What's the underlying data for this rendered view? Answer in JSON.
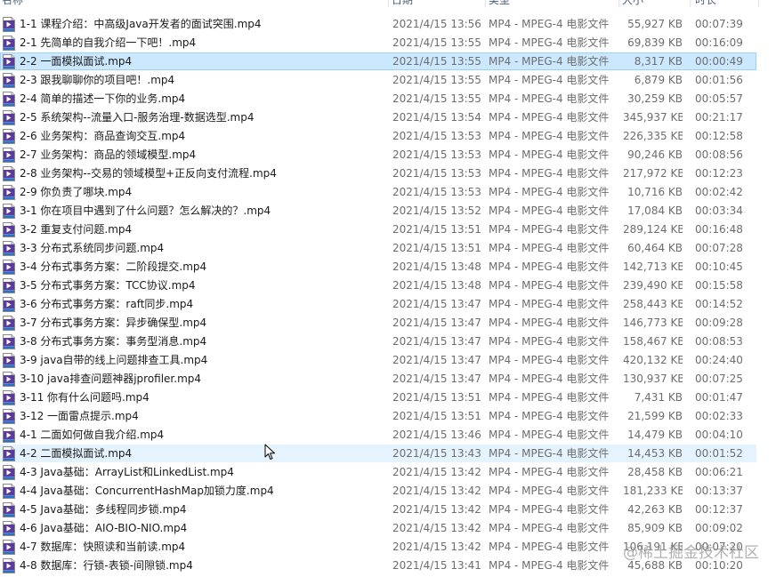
{
  "header": {
    "name": "名称",
    "date": "日期",
    "type": "类型",
    "size": "大小",
    "duration": "时长"
  },
  "icon": "mp4-video-file-icon",
  "rows": [
    {
      "name": "1-1 课程介绍：中高级Java开发者的面试突围.mp4",
      "date": "2021/4/15 13:56",
      "type": "MP4 - MPEG-4 电影文件",
      "size": "55,927 KB",
      "duration": "00:07:39"
    },
    {
      "name": "2-1 先简单的自我介绍一下吧！.mp4",
      "date": "2021/4/15 13:55",
      "type": "MP4 - MPEG-4 电影文件",
      "size": "69,839 KB",
      "duration": "00:16:09"
    },
    {
      "name": "2-2 一面模拟面试.mp4",
      "date": "2021/4/15 13:55",
      "type": "MP4 - MPEG-4 电影文件",
      "size": "8,317 KB",
      "duration": "00:00:49"
    },
    {
      "name": "2-3 跟我聊聊你的项目吧！.mp4",
      "date": "2021/4/15 13:55",
      "type": "MP4 - MPEG-4 电影文件",
      "size": "6,879 KB",
      "duration": "00:01:56"
    },
    {
      "name": "2-4 简单的描述一下你的业务.mp4",
      "date": "2021/4/15 13:55",
      "type": "MP4 - MPEG-4 电影文件",
      "size": "30,259 KB",
      "duration": "00:05:57"
    },
    {
      "name": "2-5 系统架构--流量入口-服务治理-数据选型.mp4",
      "date": "2021/4/15 13:54",
      "type": "MP4 - MPEG-4 电影文件",
      "size": "345,937 KB",
      "duration": "00:21:17"
    },
    {
      "name": "2-6 业务架构：商品查询交互.mp4",
      "date": "2021/4/15 13:53",
      "type": "MP4 - MPEG-4 电影文件",
      "size": "226,335 KB",
      "duration": "00:12:58"
    },
    {
      "name": "2-7 业务架构：商品的领域模型.mp4",
      "date": "2021/4/15 13:53",
      "type": "MP4 - MPEG-4 电影文件",
      "size": "90,246 KB",
      "duration": "00:08:56"
    },
    {
      "name": "2-8 业务架构--交易的领域模型+正反向支付流程.mp4",
      "date": "2021/4/15 13:53",
      "type": "MP4 - MPEG-4 电影文件",
      "size": "217,972 KB",
      "duration": "00:12:23"
    },
    {
      "name": "2-9 你负责了哪块.mp4",
      "date": "2021/4/15 13:53",
      "type": "MP4 - MPEG-4 电影文件",
      "size": "10,716 KB",
      "duration": "00:02:42"
    },
    {
      "name": "3-1 你在项目中遇到了什么问题？怎么解决的？.mp4",
      "date": "2021/4/15 13:52",
      "type": "MP4 - MPEG-4 电影文件",
      "size": "17,084 KB",
      "duration": "00:03:34"
    },
    {
      "name": "3-2 重复支付问题.mp4",
      "date": "2021/4/15 13:51",
      "type": "MP4 - MPEG-4 电影文件",
      "size": "289,124 KB",
      "duration": "00:16:48"
    },
    {
      "name": "3-3 分布式系统同步问题.mp4",
      "date": "2021/4/15 13:51",
      "type": "MP4 - MPEG-4 电影文件",
      "size": "60,464 KB",
      "duration": "00:07:28"
    },
    {
      "name": "3-4 分布式事务方案：二阶段提交.mp4",
      "date": "2021/4/15 13:48",
      "type": "MP4 - MPEG-4 电影文件",
      "size": "142,713 KB",
      "duration": "00:10:45"
    },
    {
      "name": "3-5 分布式事务方案：TCC协议.mp4",
      "date": "2021/4/15 13:48",
      "type": "MP4 - MPEG-4 电影文件",
      "size": "239,490 KB",
      "duration": "00:15:58"
    },
    {
      "name": "3-6 分布式事务方案：raft同步.mp4",
      "date": "2021/4/15 13:47",
      "type": "MP4 - MPEG-4 电影文件",
      "size": "258,443 KB",
      "duration": "00:14:52"
    },
    {
      "name": "3-7 分布式事务方案：异步确保型.mp4",
      "date": "2021/4/15 13:47",
      "type": "MP4 - MPEG-4 电影文件",
      "size": "146,773 KB",
      "duration": "00:09:28"
    },
    {
      "name": "3-8 分布式事务方案：事务型消息.mp4",
      "date": "2021/4/15 13:47",
      "type": "MP4 - MPEG-4 电影文件",
      "size": "158,467 KB",
      "duration": "00:08:53"
    },
    {
      "name": "3-9 java自带的线上问题排查工具.mp4",
      "date": "2021/4/15 13:47",
      "type": "MP4 - MPEG-4 电影文件",
      "size": "420,132 KB",
      "duration": "00:24:40"
    },
    {
      "name": "3-10 java排查问题神器jprofiler.mp4",
      "date": "2021/4/15 13:47",
      "type": "MP4 - MPEG-4 电影文件",
      "size": "130,937 KB",
      "duration": "00:07:25"
    },
    {
      "name": "3-11 你有什么问题吗.mp4",
      "date": "2021/4/15 13:51",
      "type": "MP4 - MPEG-4 电影文件",
      "size": "7,431 KB",
      "duration": "00:01:47"
    },
    {
      "name": "3-12 一面雷点提示.mp4",
      "date": "2021/4/15 13:51",
      "type": "MP4 - MPEG-4 电影文件",
      "size": "21,599 KB",
      "duration": "00:02:33"
    },
    {
      "name": "4-1 二面如何做自我介绍.mp4",
      "date": "2021/4/15 13:46",
      "type": "MP4 - MPEG-4 电影文件",
      "size": "14,479 KB",
      "duration": "00:04:10"
    },
    {
      "name": "4-2 二面模拟面试.mp4",
      "date": "2021/4/15 13:43",
      "type": "MP4 - MPEG-4 电影文件",
      "size": "14,453 KB",
      "duration": "00:01:52"
    },
    {
      "name": "4-3 Java基础：ArrayList和LinkedList.mp4",
      "date": "2021/4/15 13:42",
      "type": "MP4 - MPEG-4 电影文件",
      "size": "28,458 KB",
      "duration": "00:06:21"
    },
    {
      "name": "4-4 Java基础：ConcurrentHashMap加锁力度.mp4",
      "date": "2021/4/15 13:42",
      "type": "MP4 - MPEG-4 电影文件",
      "size": "181,233 KB",
      "duration": "00:13:37"
    },
    {
      "name": "4-5 Java基础：多线程同步锁.mp4",
      "date": "2021/4/15 13:42",
      "type": "MP4 - MPEG-4 电影文件",
      "size": "42,263 KB",
      "duration": "00:12:37"
    },
    {
      "name": "4-6 Java基础：AIO-BIO-NIO.mp4",
      "date": "2021/4/15 13:42",
      "type": "MP4 - MPEG-4 电影文件",
      "size": "85,909 KB",
      "duration": "00:09:02"
    },
    {
      "name": "4-7 数据库：快照读和当前读.mp4",
      "date": "2021/4/15 13:42",
      "type": "MP4 - MPEG-4 电影文件",
      "size": "106,191 KB",
      "duration": "00:07:20"
    },
    {
      "name": "4-8 数据库：行锁-表锁-间隙锁.mp4",
      "date": "2021/4/15 13:41",
      "type": "MP4 - MPEG-4 电影文件",
      "size": "45,688 KB",
      "duration": "00:10:20"
    }
  ],
  "selected_row": 2,
  "hover_row": 23,
  "watermark": "@稀土掘金技术社区"
}
